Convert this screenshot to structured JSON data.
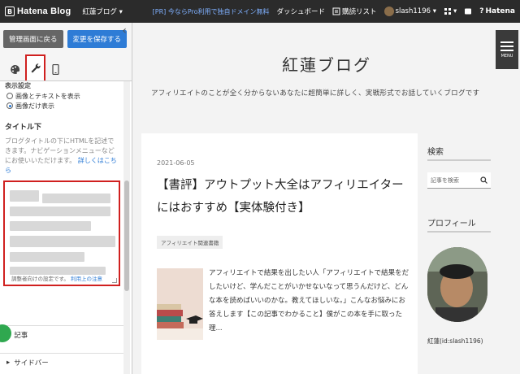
{
  "topbar": {
    "brand": "Hatena Blog",
    "blog_selector": "紅蓮ブログ ▾",
    "promo": "[PR] 今ならPro利用で独自ドメイン無料",
    "dashboard": "ダッシュボード",
    "reading_list": "購読リスト",
    "user": "slash1196 ▾",
    "hatena": "Hatena"
  },
  "editor": {
    "back_label": "管理画面に戻る",
    "save_label": "変更を保存する",
    "collapse_label": "‹",
    "tabs": [
      {
        "name": "design",
        "icon": "palette-icon"
      },
      {
        "name": "customize",
        "icon": "wrench-icon",
        "active": true
      },
      {
        "name": "smartphone",
        "icon": "smartphone-icon"
      }
    ],
    "display_setting_heading": "表示設定",
    "radio_options": [
      {
        "label": "画像とテキストを表示",
        "selected": false
      },
      {
        "label": "画像だけ表示",
        "selected": true
      }
    ],
    "section_title": "タイトル下",
    "description": "ブログタイトルの下にHTMLを記述できます。ナビゲーションメニューなどにお使いいただけます。",
    "description_link": "詳しくはこちら",
    "textarea_note": "調整者向けの設定です。",
    "textarea_note_link": "利用上の注意",
    "accordion": [
      {
        "label": "記事"
      },
      {
        "label": "サイドバー"
      }
    ]
  },
  "blog": {
    "title": "紅蓮ブログ",
    "description": "アフィリエイトのことが全く分からないあなたに超簡単に詳しく、実戦形式でお話していくブログです",
    "menu_label": "MENU",
    "post": {
      "date": "2021-06-05",
      "title": "【書評】アウトプット大全はアフィリエイターにはおすすめ【実体験付き】",
      "category": "アフィリエイト関連書籍",
      "excerpt": "アフィリエイトで結果を出したい人「アフィリエイトで結果をだしたいけど、学んだことがいかせないなって思うんだけど、どんな本を読めばいいのかな。教えてほしいな。」こんなお悩みにお答えします【この記事でわかること】僕がこの本を手に取った理..."
    },
    "sidebar": {
      "search_heading": "検索",
      "search_placeholder": "記事を検索",
      "profile_heading": "プロフィール",
      "profile_name": "紅蓮(id:slash1196)"
    }
  },
  "colors": {
    "topbar_bg": "#2b2b2b",
    "save_button": "#2e7cd6",
    "highlight_red": "#d0201f"
  }
}
